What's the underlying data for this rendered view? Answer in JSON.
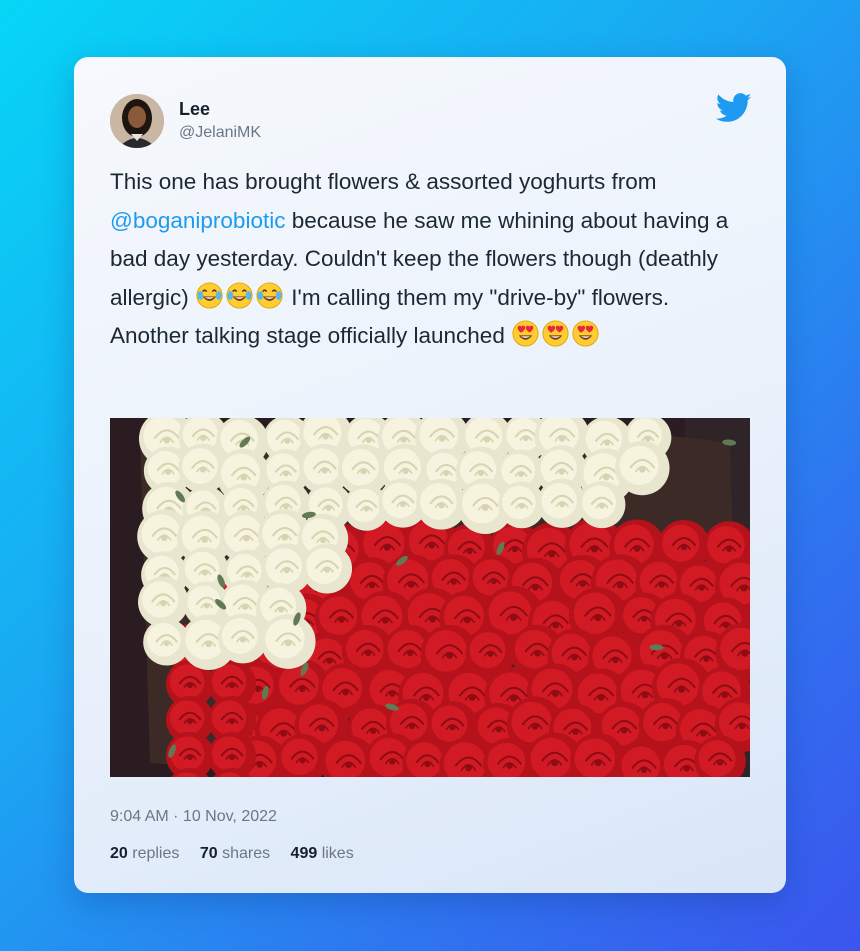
{
  "author": {
    "name": "Lee",
    "handle": "@JelaniMK"
  },
  "tweet": {
    "text_1": "This one has brought flowers & assorted yoghurts from",
    "mention": "@boganiprobiotic",
    "text_2": " because he saw me whining about having a bad day yesterday. Couldn't keep the flowers though (deathly allergic) ",
    "text_3": " I'm calling them my \"drive-by\" flowers. Another talking stage officially launched ",
    "emojis_laughing": [
      "tears-of-joy",
      "tears-of-joy",
      "tears-of-joy"
    ],
    "emojis_love": [
      "heart-eyes",
      "heart-eyes",
      "heart-eyes"
    ]
  },
  "media": {
    "type": "photo",
    "subject": "bouquet of white and red roses"
  },
  "timestamp": "9:04 AM · 10 Nov, 2022",
  "stats": {
    "replies_count": "20",
    "replies_label": " replies",
    "shares_count": "70",
    "shares_label": " shares",
    "likes_count": "499",
    "likes_label": " likes"
  },
  "colors": {
    "accent": "#1d9bf0",
    "text": "#1c2833",
    "muted": "#6b7785"
  }
}
